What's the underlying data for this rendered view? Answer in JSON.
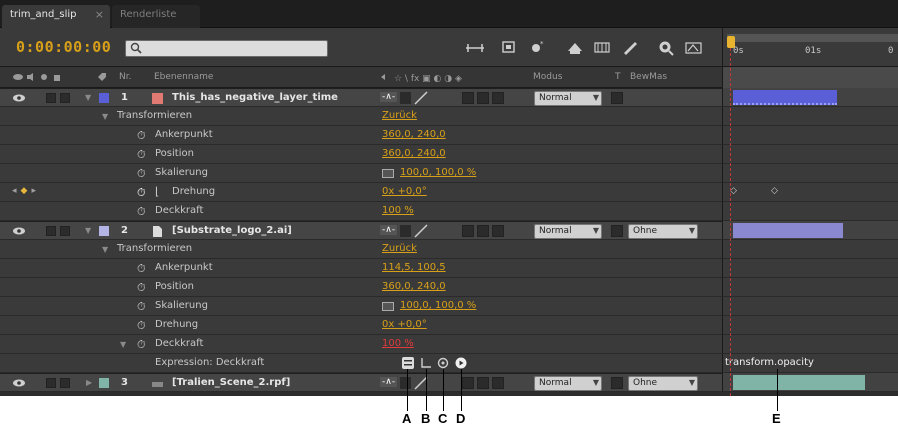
{
  "tabs": [
    {
      "label": "trim_and_slip"
    },
    {
      "label": "Renderliste"
    }
  ],
  "toolbar": {
    "timecode": "0:00:00:00",
    "search_value": ""
  },
  "ruler": {
    "ticks": [
      "0s",
      "01s",
      "0"
    ]
  },
  "columns": {
    "nr": "Nr.",
    "ebenenname": "Ebenenname",
    "modus": "Modus",
    "t": "T",
    "bewmas": "BewMas"
  },
  "layers": [
    {
      "number": "1",
      "name": "This_has_negative_layer_time",
      "label_color": "#e07a72",
      "mode": "Normal",
      "transform_label": "Transformieren",
      "reset_label": "Zurück",
      "props": [
        {
          "name": "Ankerpunkt",
          "value": "360,0, 240,0"
        },
        {
          "name": "Position",
          "value": "360,0, 240,0"
        },
        {
          "name": "Skalierung",
          "value": "100,0, 100,0 %"
        },
        {
          "name": "Drehung",
          "value": "0x +0,0°"
        },
        {
          "name": "Deckkraft",
          "value": "100 %"
        }
      ]
    },
    {
      "number": "2",
      "name": "[Substrate_logo_2.ai]",
      "label_color": "#b4b4e6",
      "mode": "Normal",
      "trkmat": "Ohne",
      "transform_label": "Transformieren",
      "reset_label": "Zurück",
      "props": [
        {
          "name": "Ankerpunkt",
          "value": "114,5, 100,5"
        },
        {
          "name": "Position",
          "value": "360,0, 240,0"
        },
        {
          "name": "Skalierung",
          "value": "100,0, 100,0 %"
        },
        {
          "name": "Drehung",
          "value": "0x +0,0°"
        },
        {
          "name": "Deckkraft",
          "value": "100 %"
        }
      ],
      "expression_label": "Expression: Deckkraft",
      "expression_text": "transform.opacity"
    },
    {
      "number": "3",
      "name": "[Tralien_Scene_2.rpf]",
      "label_color": "#7fb4a6",
      "mode": "Normal",
      "trkmat": "Ohne"
    }
  ],
  "callouts": [
    "A",
    "B",
    "C",
    "D",
    "E"
  ],
  "colors": {
    "accent_timecode": "#d8a018",
    "current_time_indicator": "#e8b430",
    "layer1_bar": "#5a5fd8",
    "layer2_bar": "#8a88d0",
    "layer3_bar": "#7fb4a6"
  }
}
